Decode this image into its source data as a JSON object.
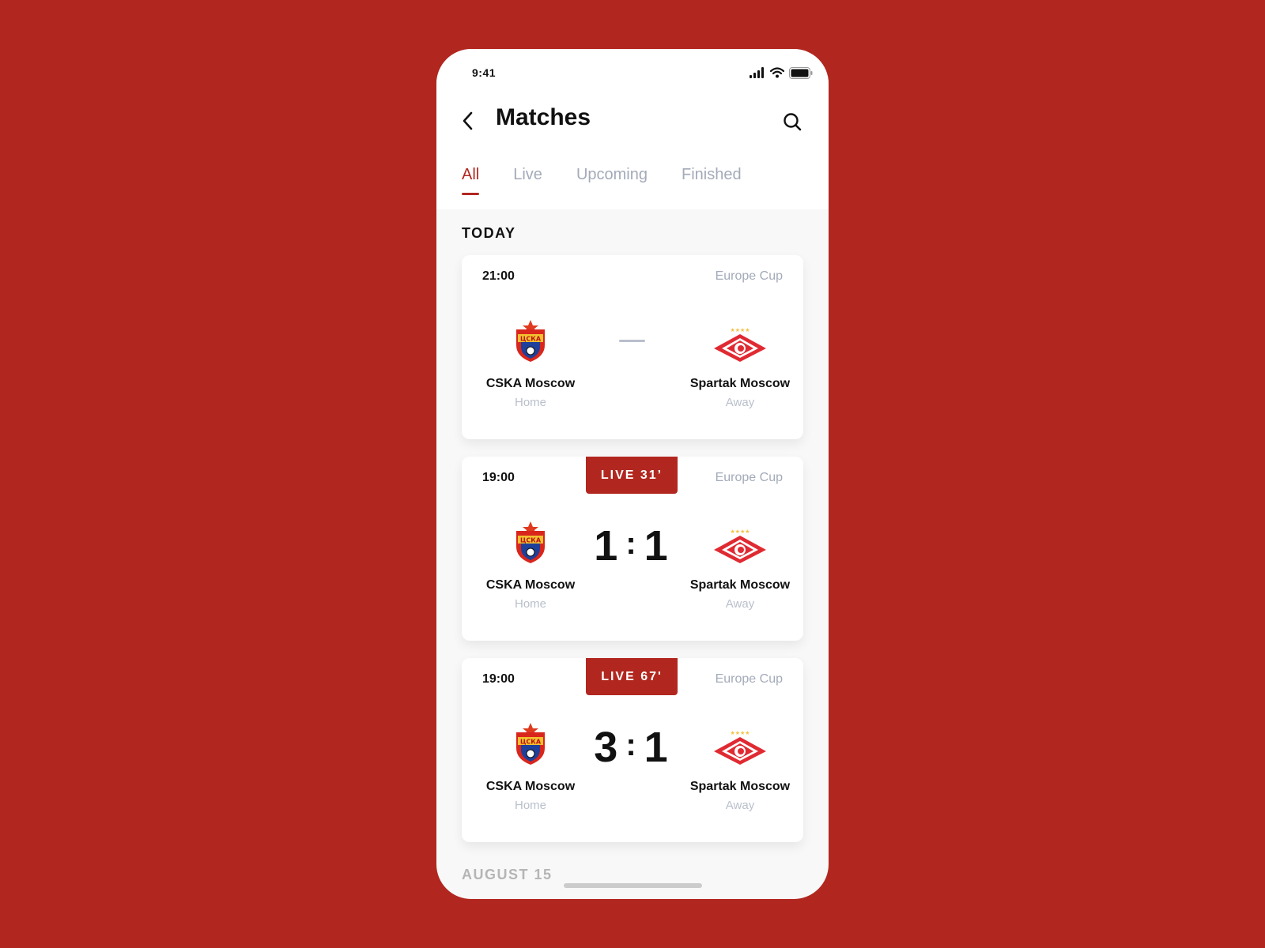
{
  "status_bar": {
    "time": "9:41",
    "icons": [
      "signal-icon",
      "wifi-icon",
      "battery-icon"
    ]
  },
  "header": {
    "title": "Matches",
    "back_icon": "chevron-left-icon",
    "search_icon": "search-icon"
  },
  "tabs": [
    {
      "label": "All",
      "active": true
    },
    {
      "label": "Live",
      "active": false
    },
    {
      "label": "Upcoming",
      "active": false
    },
    {
      "label": "Finished",
      "active": false
    }
  ],
  "sections": [
    {
      "label": "TODAY"
    },
    {
      "label": "AUGUST 15"
    }
  ],
  "matches": [
    {
      "time": "21:00",
      "competition": "Europe Cup",
      "live": "",
      "score_home": "",
      "score_away": "",
      "home": {
        "name": "CSKA Moscow",
        "role": "Home"
      },
      "away": {
        "name": "Spartak Moscow",
        "role": "Away"
      }
    },
    {
      "time": "19:00",
      "competition": "Europe Cup",
      "live": "LIVE 31’",
      "score_home": "1",
      "score_away": "1",
      "home": {
        "name": "CSKA Moscow",
        "role": "Home"
      },
      "away": {
        "name": "Spartak Moscow",
        "role": "Away"
      }
    },
    {
      "time": "19:00",
      "competition": "Europe Cup",
      "live": "LIVE 67'",
      "score_home": "3",
      "score_away": "1",
      "home": {
        "name": "CSKA Moscow",
        "role": "Home"
      },
      "away": {
        "name": "Spartak Moscow",
        "role": "Away"
      }
    }
  ],
  "score_separator": ":",
  "colors": {
    "accent": "#b1271f",
    "muted": "#a3aab9",
    "text": "#111111"
  }
}
